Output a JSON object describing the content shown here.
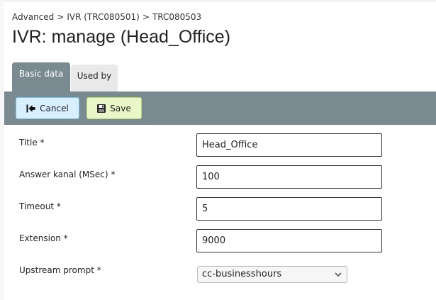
{
  "breadcrumb": {
    "items": [
      "Advanced",
      "IVR (TRC080501)",
      "TRC080503"
    ],
    "separator": ">"
  },
  "page": {
    "title": "IVR: manage (Head_Office)"
  },
  "tabs": [
    {
      "label": "Basic data",
      "active": true
    },
    {
      "label": "Used by",
      "active": false
    }
  ],
  "toolbar": {
    "cancel_label": "Cancel",
    "cancel_icon": "back-arrow-icon",
    "save_label": "Save",
    "save_icon": "floppy-disk-icon"
  },
  "form": {
    "title": {
      "label": "Title *",
      "value": "Head_Office"
    },
    "answer": {
      "label": "Answer kanal (MSec) *",
      "value": "100"
    },
    "timeout": {
      "label": "Timeout *",
      "value": "5"
    },
    "extension": {
      "label": "Extension *",
      "value": "9000"
    },
    "upstream": {
      "label": "Upstream prompt *",
      "value": "cc-businesshours"
    }
  },
  "colors": {
    "toolbar": "#7a8a91",
    "tab_active": "#7a8a91",
    "tab_inactive": "#e9e9e9",
    "cancel_bg": "#d7efff",
    "save_bg": "#e9f7c8"
  }
}
